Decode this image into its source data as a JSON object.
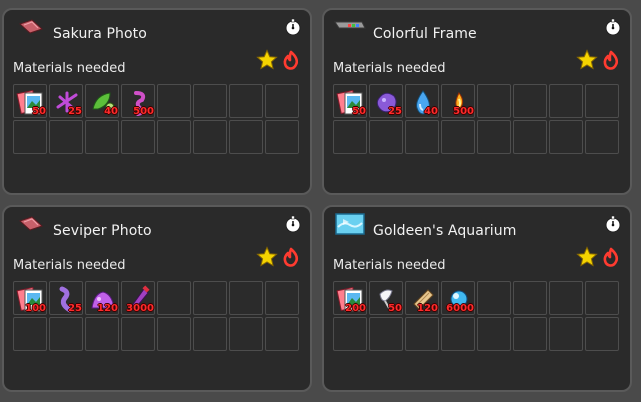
{
  "common": {
    "materials_label": "Materials needed",
    "colors": {
      "panel": "#2a2a2a",
      "border": "#5a5a5a",
      "qty": "#ff2a2a",
      "star": "#f5d400",
      "fire": "#ff3b30"
    }
  },
  "cards": [
    {
      "title": "Sakura Photo",
      "thumb_icon": "pink-photo-thumbnail-icon",
      "materials": [
        {
          "icon": "photo-stack-icon",
          "qty": "50"
        },
        {
          "icon": "purple-sparkle-icon",
          "qty": "25"
        },
        {
          "icon": "green-leaf-icon",
          "qty": "40"
        },
        {
          "icon": "pink-ribbon-icon",
          "qty": "500"
        }
      ]
    },
    {
      "title": "Colorful Frame",
      "thumb_icon": "colorful-frame-thumbnail-icon",
      "materials": [
        {
          "icon": "photo-stack-icon",
          "qty": "50"
        },
        {
          "icon": "purple-blob-icon",
          "qty": "25"
        },
        {
          "icon": "water-drop-icon",
          "qty": "40"
        },
        {
          "icon": "fire-spark-icon",
          "qty": "500"
        }
      ]
    },
    {
      "title": "Seviper Photo",
      "thumb_icon": "pink-photo-thumbnail-icon",
      "materials": [
        {
          "icon": "photo-stack-icon",
          "qty": "100"
        },
        {
          "icon": "purple-worm-icon",
          "qty": "25"
        },
        {
          "icon": "purple-slime-icon",
          "qty": "120"
        },
        {
          "icon": "fang-icon",
          "qty": "3000"
        }
      ]
    },
    {
      "title": "Goldeen's Aquarium",
      "thumb_icon": "aquarium-thumbnail-icon",
      "materials": [
        {
          "icon": "photo-stack-icon",
          "qty": "200"
        },
        {
          "icon": "white-feather-icon",
          "qty": "50"
        },
        {
          "icon": "scroll-icon",
          "qty": "120"
        },
        {
          "icon": "blue-orb-icon",
          "qty": "6000"
        }
      ]
    }
  ]
}
